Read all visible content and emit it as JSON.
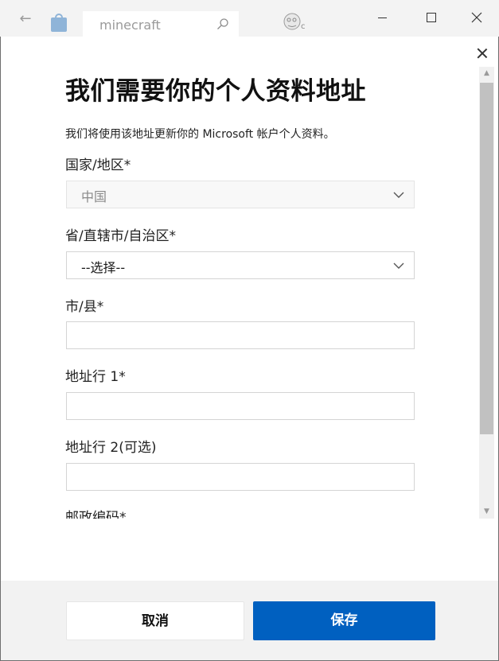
{
  "titlebar": {
    "search_text": "minecraft",
    "window_controls": [
      "minimize",
      "maximize",
      "close"
    ]
  },
  "dialog": {
    "title": "我们需要你的个人资料地址",
    "subtitle": "我们将使用该地址更新你的 Microsoft 帐户个人资料。",
    "fields": {
      "country": {
        "label": "国家/地区*",
        "value": "中国"
      },
      "province": {
        "label": "省/直辖市/自治区*",
        "value": "--选择--"
      },
      "city": {
        "label": "市/县*",
        "value": ""
      },
      "address1": {
        "label": "地址行 1*",
        "value": ""
      },
      "address2": {
        "label": "地址行 2(可选)",
        "value": ""
      },
      "postal": {
        "label": "邮政编码*"
      }
    },
    "buttons": {
      "cancel": "取消",
      "save": "保存"
    },
    "colors": {
      "primary": "#0060c0",
      "footer_bg": "#f2f2f2"
    }
  }
}
